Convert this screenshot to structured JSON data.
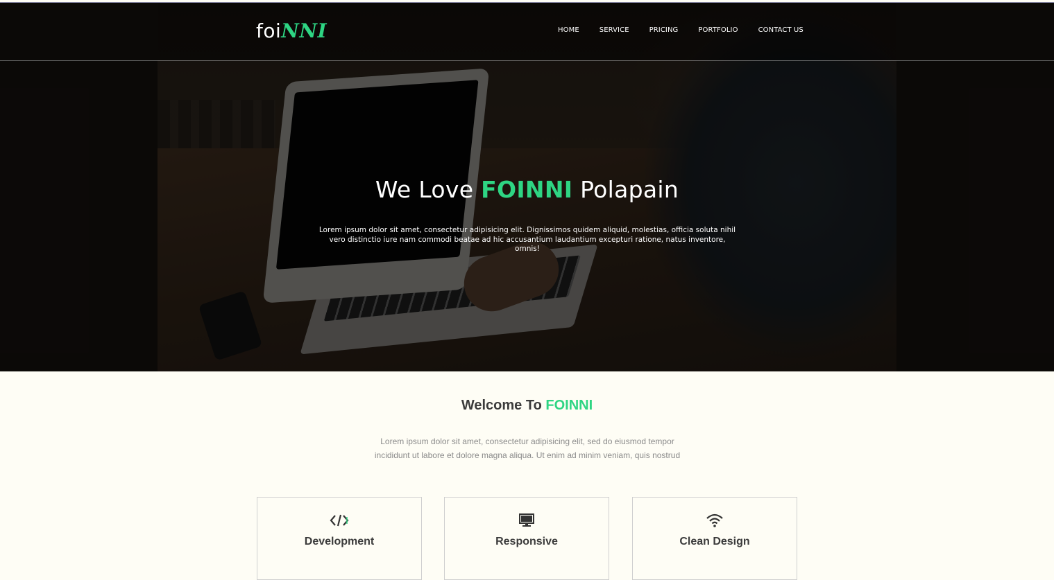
{
  "brand": {
    "logo_prefix": "foi",
    "logo_accent": "NNI",
    "accent_color": "#2ed583"
  },
  "nav": {
    "items": [
      {
        "label": "HOME"
      },
      {
        "label": "SERVICE"
      },
      {
        "label": "PRICING"
      },
      {
        "label": "PORTFOLIO"
      },
      {
        "label": "CONTACT US"
      }
    ]
  },
  "hero": {
    "title_before": "We Love ",
    "title_accent": "FOINNI",
    "title_after": " Polapain",
    "text": "Lorem ipsum dolor sit amet, consectetur adipisicing elit. Dignissimos quidem aliquid, molestias, officia soluta nihil vero distinctio iure nam commodi beatae ad hic accusantium laudantium excepturi ratione, natus inventore, omnis!"
  },
  "welcome": {
    "title_before": "Welcome To ",
    "title_accent": "FOINNI",
    "text": "Lorem ipsum dolor sit amet, consectetur adipisicing elit, sed do eiusmod tempor incididunt ut labore et dolore magna aliqua. Ut enim ad minim veniam, quis nostrud"
  },
  "features": [
    {
      "icon": "code-icon",
      "title": "Development"
    },
    {
      "icon": "desktop-icon",
      "title": "Responsive"
    },
    {
      "icon": "wifi-icon",
      "title": "Clean Design"
    }
  ]
}
